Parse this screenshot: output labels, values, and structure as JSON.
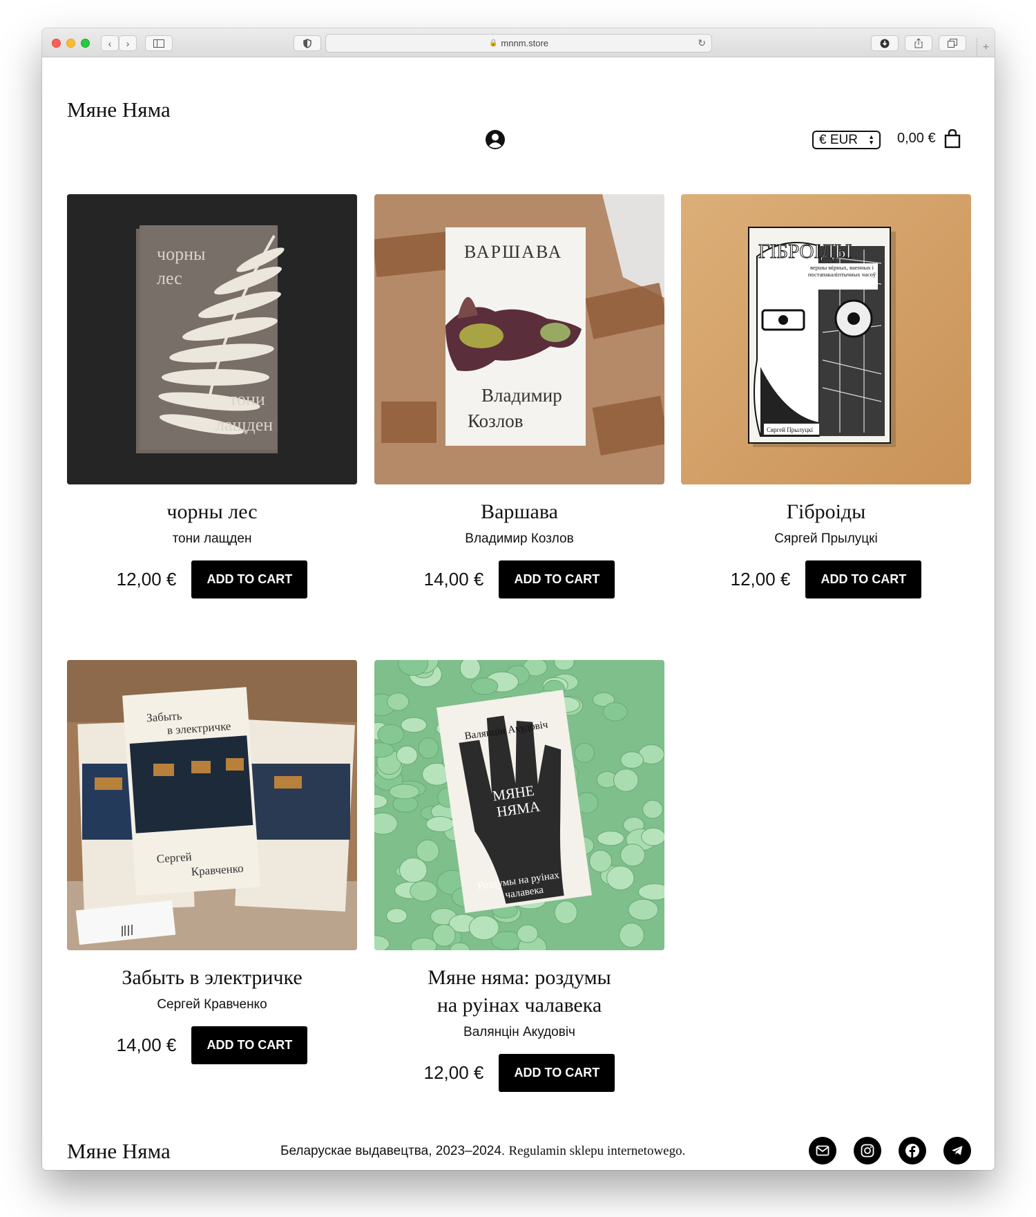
{
  "browser": {
    "url": "mnnm.store"
  },
  "header": {
    "logo": "Мяне Няма",
    "currency": "€ EUR",
    "cart_total": "0,00 €"
  },
  "products": [
    {
      "title": "чорны лес",
      "author": "тони лащден",
      "price": "12,00 €",
      "button": "ADD TO CART",
      "cover_text": [
        "чорны",
        "лес",
        "тони",
        "лащден"
      ]
    },
    {
      "title": "Варшава",
      "author": "Владимир Козлов",
      "price": "14,00 €",
      "button": "ADD TO CART",
      "cover_text": [
        "ВАРШАВА",
        "Владимир",
        "Козлов"
      ]
    },
    {
      "title": "Гіброіды",
      "author": "Сяргей Прылуцкі",
      "price": "12,00 €",
      "button": "ADD TO CART",
      "cover_text": [
        "ГІБРОІДЫ",
        "вершы мірных, ваенных і постапакаліптычных часоў",
        "Сяргей Прылуцкі"
      ]
    },
    {
      "title": "Забыть в электричке",
      "author": "Сергей Кравченко",
      "price": "14,00 €",
      "button": "ADD TO CART",
      "cover_text": [
        "Забыть",
        "в электричке",
        "Сергей",
        "Кравченко"
      ]
    },
    {
      "title_line1": "Мяне няма: роздумы",
      "title_line2": "на руінах чалавека",
      "author": "Валянцін Акудовіч",
      "price": "12,00 €",
      "button": "ADD TO CART",
      "cover_text": [
        "Валянцін Акудовіч",
        "МЯНЕ",
        "НЯМА",
        "Роздумы на руінах",
        "чалавека"
      ]
    }
  ],
  "footer": {
    "logo": "Мяне Няма",
    "text": "Беларускае выдавецтва, 2023–2024.",
    "link": "Regulamin sklepu internetowego."
  },
  "icons": [
    "account-icon",
    "cart-icon",
    "email-icon",
    "instagram-icon",
    "facebook-icon",
    "telegram-icon"
  ]
}
